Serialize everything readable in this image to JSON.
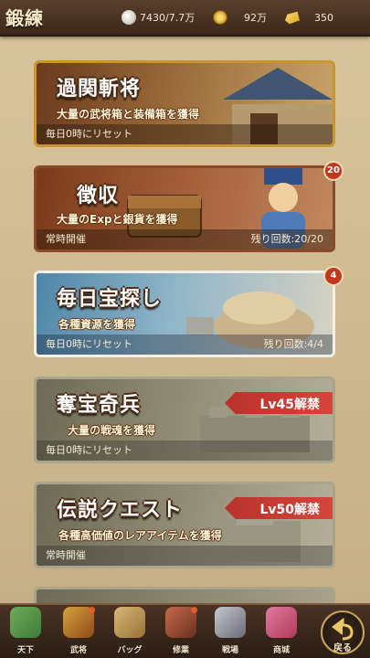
{
  "header": {
    "title": "鍛練",
    "stamina": "7430/7.7万",
    "coins": "92万",
    "gold": "350"
  },
  "cards": [
    {
      "title": "過関斬将",
      "subtitle": "大量の武将箱と装備箱を獲得",
      "footer_left": "毎日0時にリセット",
      "footer_right": ""
    },
    {
      "title": "徴収",
      "subtitle": "大量のExpと銀貨を獲得",
      "footer_left": "常時開催",
      "footer_right": "残り回数:20/20",
      "badge": "20"
    },
    {
      "title": "毎日宝探し",
      "subtitle": "各種資源を獲得",
      "footer_left": "毎日0時にリセット",
      "footer_right": "残り回数:4/4",
      "badge": "4"
    },
    {
      "title": "奪宝奇兵",
      "subtitle": "大量の戦魂を獲得",
      "footer_left": "毎日0時にリセット",
      "footer_right": "",
      "lock": "Lv45解禁"
    },
    {
      "title": "伝説クエスト",
      "subtitle": "各種高価値のレアアイテムを獲得",
      "footer_left": "常時開催",
      "footer_right": "",
      "lock": "Lv50解禁"
    }
  ],
  "nav": {
    "items": [
      "天下",
      "武将",
      "バッグ",
      "修業",
      "戦場",
      "商城"
    ],
    "back": "戻る"
  },
  "colors": {
    "card_gold": "#c9962e",
    "card_brown": "#8a4a2a",
    "card_blue": "#5f93b0",
    "card_locked": "#8f8a73",
    "lock_red": "#c83a2e"
  }
}
